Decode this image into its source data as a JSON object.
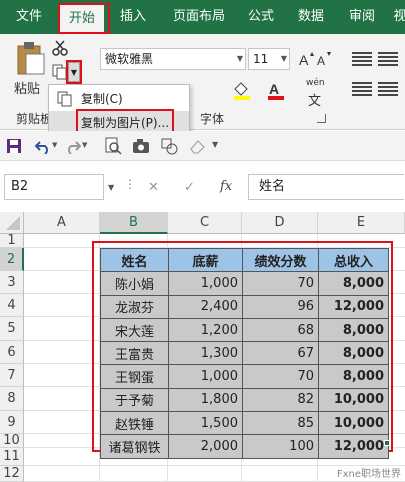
{
  "ribbon_tabs": [
    "文件",
    "开始",
    "插入",
    "页面布局",
    "公式",
    "数据",
    "审阅",
    "视"
  ],
  "active_tab": "开始",
  "clipboard": {
    "paste_label": "粘贴",
    "group_label": "剪贴板"
  },
  "font": {
    "name": "微软雅黑",
    "size": "11",
    "group_label": "字体",
    "wen_label": "wén"
  },
  "popup_menu": {
    "items": [
      "复制(C)",
      "复制为图片(P)..."
    ]
  },
  "name_box": "B2",
  "formula_bar": {
    "fx": "fx",
    "value": "姓名",
    "cancel": "✕",
    "enter": "✓"
  },
  "columns": [
    "A",
    "B",
    "C",
    "D",
    "E"
  ],
  "rows": [
    "1",
    "2",
    "3",
    "4",
    "5",
    "6",
    "7",
    "8",
    "9",
    "10",
    "11",
    "12"
  ],
  "table": {
    "headers": [
      "姓名",
      "底薪",
      "绩效分数",
      "总收入"
    ],
    "rows": [
      [
        "陈小娟",
        "1,000",
        "70",
        "8,000"
      ],
      [
        "龙淑芬",
        "2,400",
        "96",
        "12,000"
      ],
      [
        "宋大莲",
        "1,200",
        "68",
        "8,000"
      ],
      [
        "王富贵",
        "1,300",
        "67",
        "8,000"
      ],
      [
        "王钢蛋",
        "1,000",
        "70",
        "8,000"
      ],
      [
        "于予菊",
        "1,800",
        "82",
        "10,000"
      ],
      [
        "赵铁锤",
        "1,500",
        "85",
        "10,000"
      ],
      [
        "诸葛钢铁",
        "2,000",
        "100",
        "12,000"
      ]
    ]
  },
  "watermark": "Fxne职场世界",
  "colors": {
    "ribbon_green": "#217346",
    "highlight_red": "#e0101a",
    "header_blue": "#9dc3e6",
    "body_gray": "#c9c9c9"
  }
}
